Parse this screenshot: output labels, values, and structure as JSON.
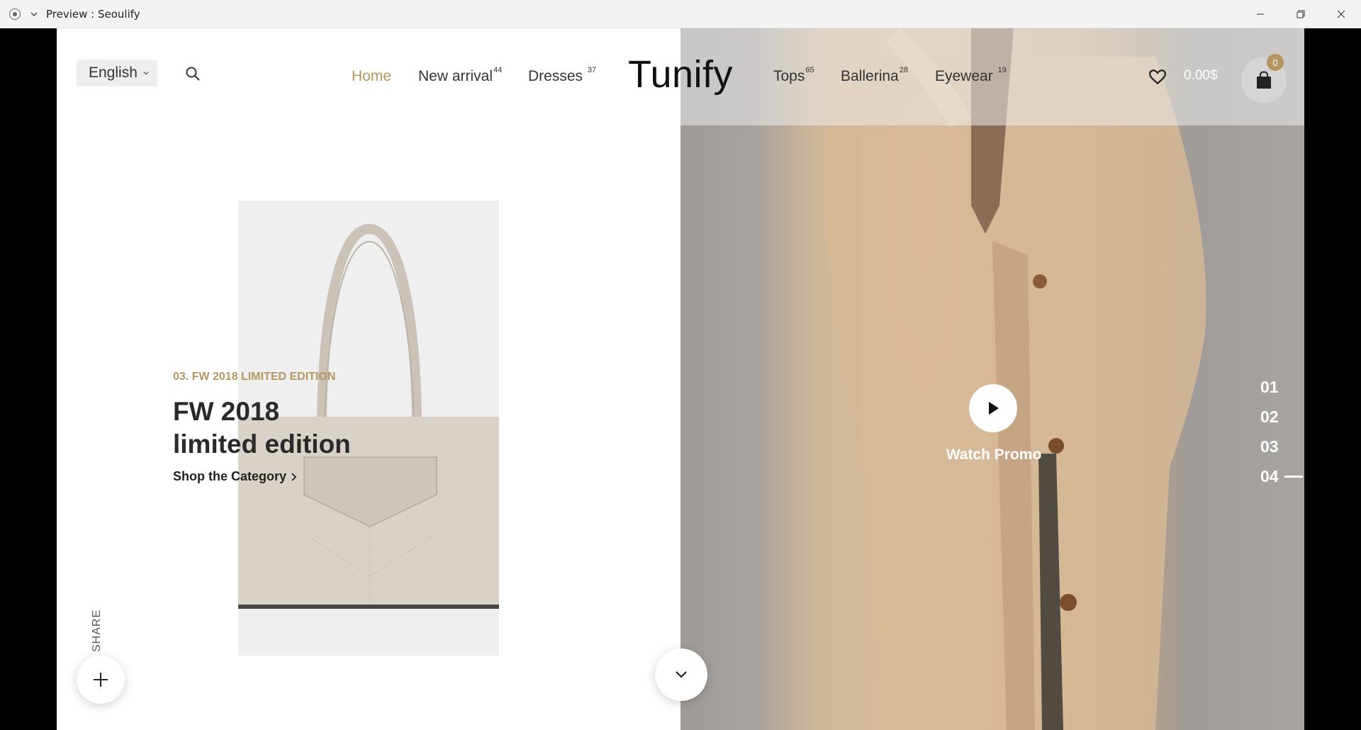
{
  "window": {
    "title": "Preview : Seoulify",
    "controls": [
      "minimize-icon",
      "restore-icon",
      "close-icon"
    ]
  },
  "header": {
    "language": "English",
    "logo": "Tunify",
    "nav": [
      {
        "label": "Home",
        "count": "",
        "active": true
      },
      {
        "label": "New arrival",
        "count": "44",
        "active": false
      },
      {
        "label": "Dresses",
        "count": "37",
        "active": false
      },
      {
        "label": "Tops",
        "count": "65",
        "active": false
      },
      {
        "label": "Ballerina",
        "count": "28",
        "active": false
      },
      {
        "label": "Eyewear",
        "count": "19",
        "active": false
      }
    ],
    "cart_total": "0.00$",
    "cart_count": "0"
  },
  "slide": {
    "eyebrow": "03. FW 2018 LIMITED EDITION",
    "headline_line1": "FW 2018",
    "headline_line2": "limited edition",
    "link": "Shop the Category"
  },
  "share_label": "SHARE",
  "promo": {
    "label": "Watch Promo"
  },
  "slide_numbers": [
    "01",
    "02",
    "03",
    "04"
  ],
  "active_slide": "04",
  "colors": {
    "accent": "#b59560",
    "text": "#2a2a2a",
    "background": "#ffffff"
  }
}
